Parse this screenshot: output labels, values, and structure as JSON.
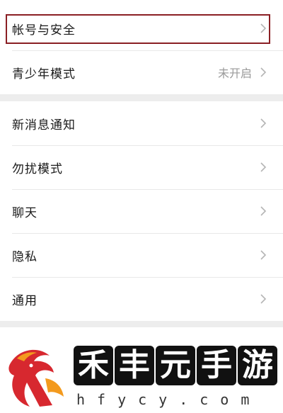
{
  "groups": [
    {
      "items": [
        {
          "label": "帐号与安全",
          "value": ""
        },
        {
          "label": "青少年模式",
          "value": "未开启"
        }
      ]
    },
    {
      "items": [
        {
          "label": "新消息通知",
          "value": ""
        },
        {
          "label": "勿扰模式",
          "value": ""
        },
        {
          "label": "聊天",
          "value": ""
        },
        {
          "label": "隐私",
          "value": ""
        },
        {
          "label": "通用",
          "value": ""
        }
      ]
    }
  ],
  "watermark": {
    "chars": [
      "禾",
      "丰",
      "元",
      "手",
      "游"
    ],
    "domain": "hfycy.com"
  },
  "colors": {
    "background": "#ededed",
    "highlight_border": "#8a1f24",
    "logo_red": "#d7282f",
    "logo_orange": "#f39a1e"
  }
}
